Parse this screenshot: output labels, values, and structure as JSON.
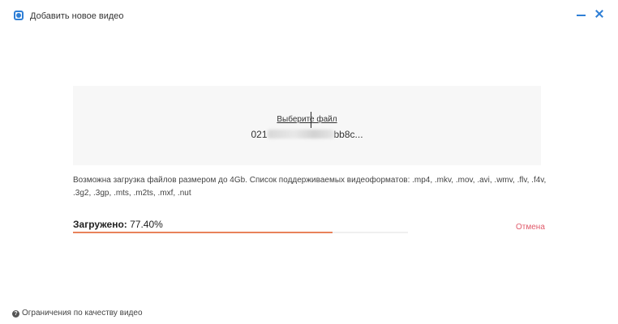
{
  "window": {
    "title": "Добавить новое видео",
    "app_icon": "app-logo-icon",
    "minimize_icon": "minimize-icon",
    "close_icon": "close-icon",
    "accent_color": "#2f7fd6"
  },
  "upload": {
    "choose_file_label": "Выберите файл",
    "filename_prefix": "021",
    "filename_suffix": "bb8c...",
    "info_text": "Возможна загрузка файлов размером до 4Gb. Список поддерживаемых видеоформатов: .mp4, .mkv, .mov, .avi, .wmv, .flv, .f4v, .3g2, .3gp, .mts, .m2ts, .mxf, .nut"
  },
  "progress": {
    "label": "Загружено:",
    "value_text": "77.40%",
    "fraction": 0.774,
    "bar_color": "#e8825a",
    "cancel_label": "Отмена",
    "cancel_color": "#e05a6a"
  },
  "footer": {
    "help_icon": "question-circle-icon",
    "link_label": "Ограничения по качеству видео"
  }
}
